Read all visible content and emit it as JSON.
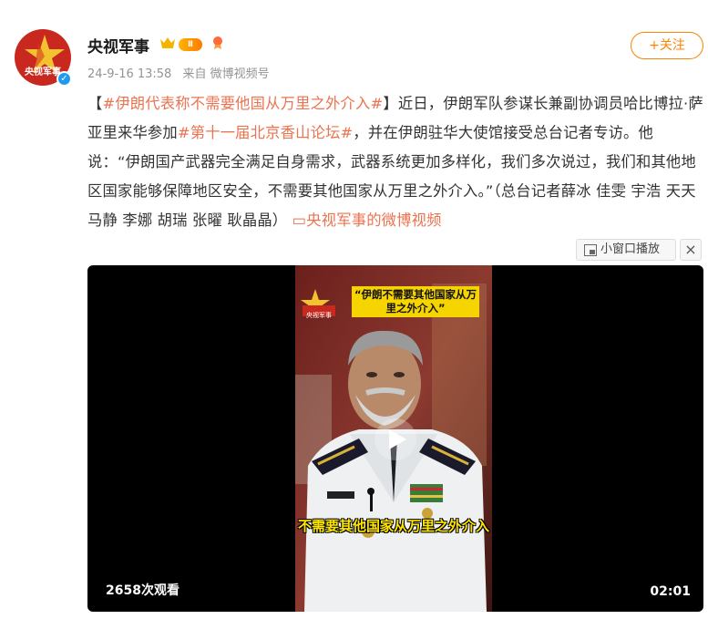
{
  "account": {
    "name": "央视军事",
    "avatar_label": "央视军事",
    "timestamp": "24-9-16 13:58",
    "source": "来自 微博视频号",
    "level": "Ⅱ"
  },
  "follow_button_label": "+关注",
  "post": {
    "bracket_open": "【",
    "hashtag_1": "#伊朗代表称不需要他国从万里之外介入#",
    "bracket_close": "】",
    "text_1": "近日，伊朗军队参谋长兼副协调员哈比博拉·萨亚里来华参加",
    "hashtag_2": "#第十一届北京香山论坛#",
    "text_2": "，并在伊朗驻华大使馆接受总台记者专访。他说：“伊朗国产武器完全满足自身需求，武器系统更加多样化，我们多次说过，我们和其他地区国家能够保障地区安全，不需要其他国家从万里之外介入。”（总台记者薛冰 佳雯 宇浩 天天 马静 李娜 胡瑞 张曜 耿晶晶）",
    "video_link": "央视军事的微博视频"
  },
  "video": {
    "mini_window_label": "小窗口播放",
    "close_label": "×",
    "caption_top": "“伊朗不需要其他国家从万里之外介入”",
    "caption_bottom": "不需要其他国家从万里之外介入",
    "channel_logo_label": "央视军事",
    "view_count": "2658次观看",
    "duration": "02:01"
  },
  "colors": {
    "link": "#eb7350",
    "follow": "#ff8200",
    "caption_bg": "#f5d400"
  }
}
